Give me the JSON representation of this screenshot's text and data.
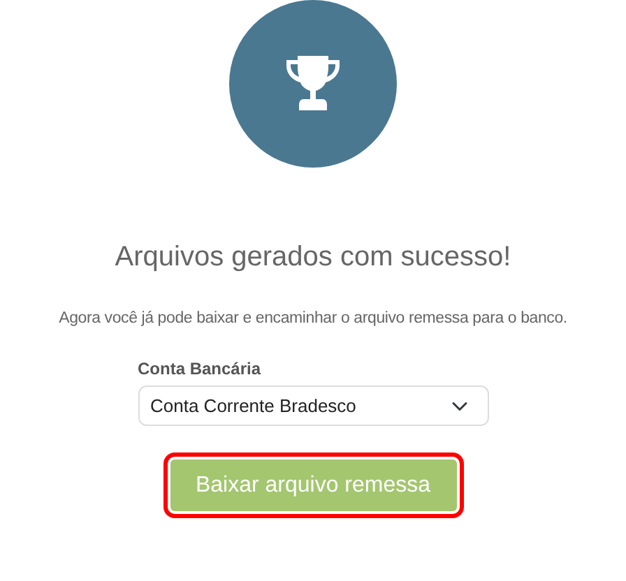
{
  "title": "Arquivos gerados com sucesso!",
  "message": "Agora você já pode baixar e encaminhar o arquivo remessa para o banco.",
  "account_field": {
    "label": "Conta Bancária",
    "value": "Conta Corrente Bradesco"
  },
  "download_button": {
    "label": "Baixar arquivo remessa",
    "highlighted": true
  }
}
